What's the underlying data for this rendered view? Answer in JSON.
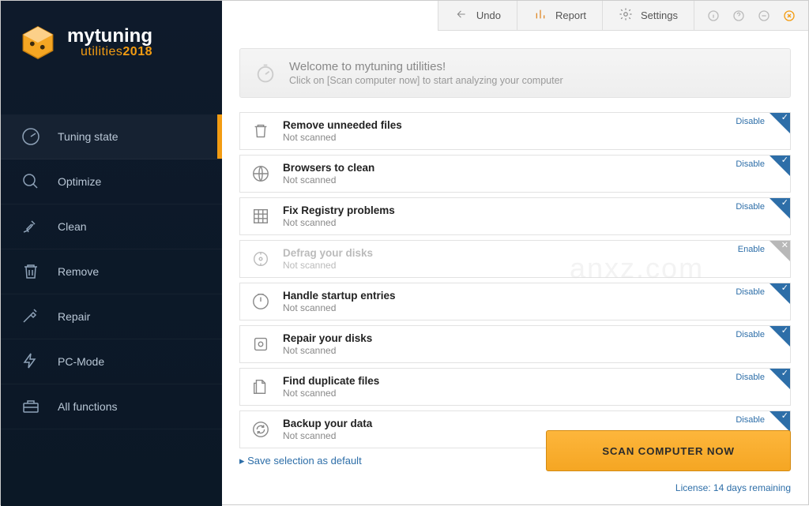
{
  "brand": {
    "name": "mytuning",
    "suite": "utilities",
    "year": "2018"
  },
  "topbar": {
    "undo": "Undo",
    "report": "Report",
    "settings": "Settings"
  },
  "sidebar": {
    "items": [
      {
        "label": "Tuning state",
        "icon": "gauge-icon",
        "active": true
      },
      {
        "label": "Optimize",
        "icon": "magnify-icon"
      },
      {
        "label": "Clean",
        "icon": "broom-icon"
      },
      {
        "label": "Remove",
        "icon": "trash-icon"
      },
      {
        "label": "Repair",
        "icon": "screwdriver-icon"
      },
      {
        "label": "PC-Mode",
        "icon": "bolt-icon"
      },
      {
        "label": "All functions",
        "icon": "toolbox-icon"
      }
    ]
  },
  "welcome": {
    "title": "Welcome to mytuning utilities!",
    "subtitle": "Click on [Scan computer now] to start analyzing your computer"
  },
  "tasks": [
    {
      "title": "Remove unneeded files",
      "status": "Not scanned",
      "toggle": "Disable",
      "enabled": true
    },
    {
      "title": "Browsers to clean",
      "status": "Not scanned",
      "toggle": "Disable",
      "enabled": true
    },
    {
      "title": "Fix Registry problems",
      "status": "Not scanned",
      "toggle": "Disable",
      "enabled": true
    },
    {
      "title": "Defrag your disks",
      "status": "Not scanned",
      "toggle": "Enable",
      "enabled": false
    },
    {
      "title": "Handle startup entries",
      "status": "Not scanned",
      "toggle": "Disable",
      "enabled": true
    },
    {
      "title": "Repair your disks",
      "status": "Not scanned",
      "toggle": "Disable",
      "enabled": true
    },
    {
      "title": "Find duplicate files",
      "status": "Not scanned",
      "toggle": "Disable",
      "enabled": true
    },
    {
      "title": "Backup your data",
      "status": "Not scanned",
      "toggle": "Disable",
      "enabled": true
    }
  ],
  "save_default": "Save selection as default",
  "scan_button": "SCAN COMPUTER NOW",
  "license": "License: 14 days remaining",
  "watermark": "anxz.com"
}
